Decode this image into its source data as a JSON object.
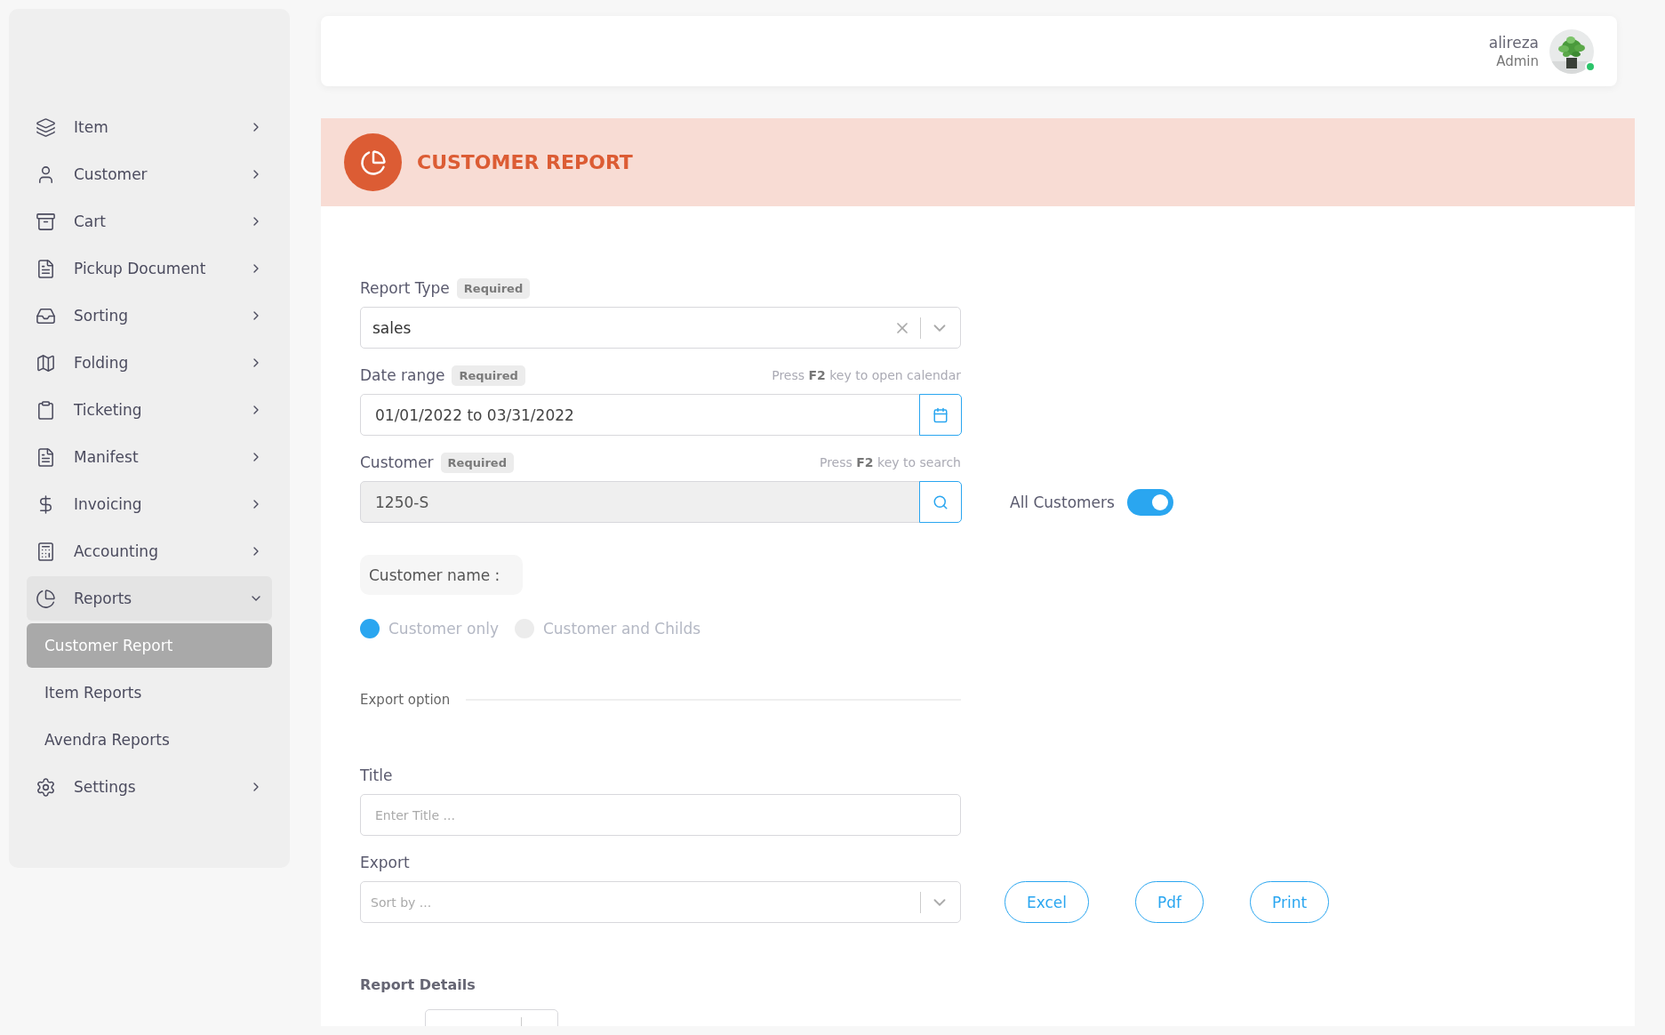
{
  "user": {
    "name": "alireza",
    "role": "Admin"
  },
  "sidebar": {
    "items": [
      {
        "label": "Item",
        "expanded": false
      },
      {
        "label": "Customer",
        "expanded": false
      },
      {
        "label": "Cart",
        "expanded": false
      },
      {
        "label": "Pickup Document",
        "expanded": false
      },
      {
        "label": "Sorting",
        "expanded": false
      },
      {
        "label": "Folding",
        "expanded": false
      },
      {
        "label": "Ticketing",
        "expanded": false
      },
      {
        "label": "Manifest",
        "expanded": false
      },
      {
        "label": "Invoicing",
        "expanded": false
      },
      {
        "label": "Accounting",
        "expanded": false
      },
      {
        "label": "Reports",
        "expanded": true,
        "children": [
          {
            "label": "Customer Report",
            "selected": true
          },
          {
            "label": "Item Reports",
            "selected": false
          },
          {
            "label": "Avendra Reports",
            "selected": false
          }
        ]
      },
      {
        "label": "Settings",
        "expanded": false
      }
    ]
  },
  "page_title": "CUSTOMER REPORT",
  "form": {
    "report_type": {
      "label": "Report Type",
      "badge": "Required",
      "value": "sales"
    },
    "date_range": {
      "label": "Date range",
      "badge": "Required",
      "hint": "Press **F2** key to open calendar",
      "value": "01/01/2022 to 03/31/2022"
    },
    "customer": {
      "label": "Customer",
      "badge": "Required",
      "hint": "Press **F2** key to search",
      "value": "1250-S",
      "disabled": true
    },
    "all_customers": {
      "label": "All Customers",
      "on": true
    },
    "customer_name": "Customer name :",
    "scope_options": [
      {
        "label": "Customer only",
        "selected": true
      },
      {
        "label": "Customer and Childs",
        "selected": false
      }
    ],
    "export_section": "Export option",
    "title_field": {
      "label": "Title",
      "placeholder": "Enter Title ..."
    },
    "export_field": {
      "label": "Export",
      "placeholder": "Sort by ..."
    },
    "export_buttons": [
      "Excel",
      "Pdf",
      "Print"
    ]
  },
  "report_details": {
    "heading": "Report Details"
  }
}
